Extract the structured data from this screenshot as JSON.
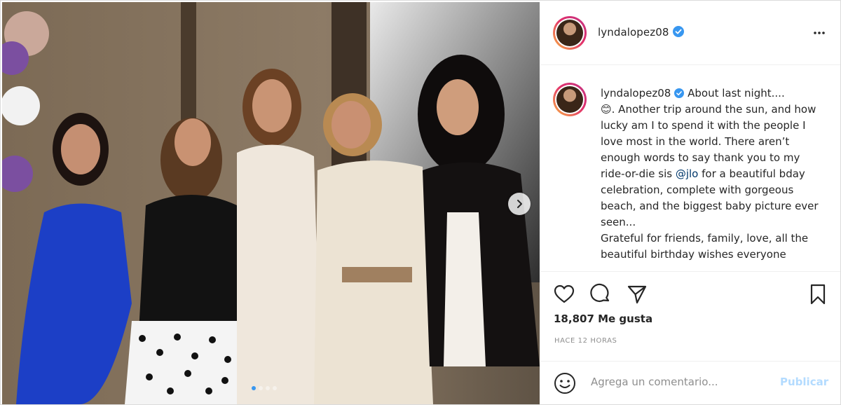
{
  "post": {
    "username": "lyndalopez08",
    "verified": true,
    "more_icon": "more-horizontal-icon",
    "media": {
      "alt": "",
      "carousel_count": 4,
      "carousel_active": 0,
      "next_icon": "chevron-right-icon"
    },
    "caption": {
      "part1": "About last night....",
      "emoji": "😊",
      "part2": ". Another trip around the sun, and how lucky am I to spend it with the people I love most in the world. There aren’t enough words to say thank you to my ride-or-die sis ",
      "mention": "@jlo",
      "part3": " for a beautiful bday celebration, complete with gorgeous beach, and the biggest baby picture ever seen...",
      "part4": "Grateful for friends, family, love, all the beautiful birthday wishes everyone"
    },
    "likes_text": "18,807 Me gusta",
    "time_text": "HACE 12 HORAS",
    "comment_placeholder": "Agrega un comentario...",
    "publish_label": "Publicar",
    "colors": {
      "verified": "#3897f0",
      "publish_disabled": "#b3dbff",
      "mention": "#00376b"
    }
  }
}
